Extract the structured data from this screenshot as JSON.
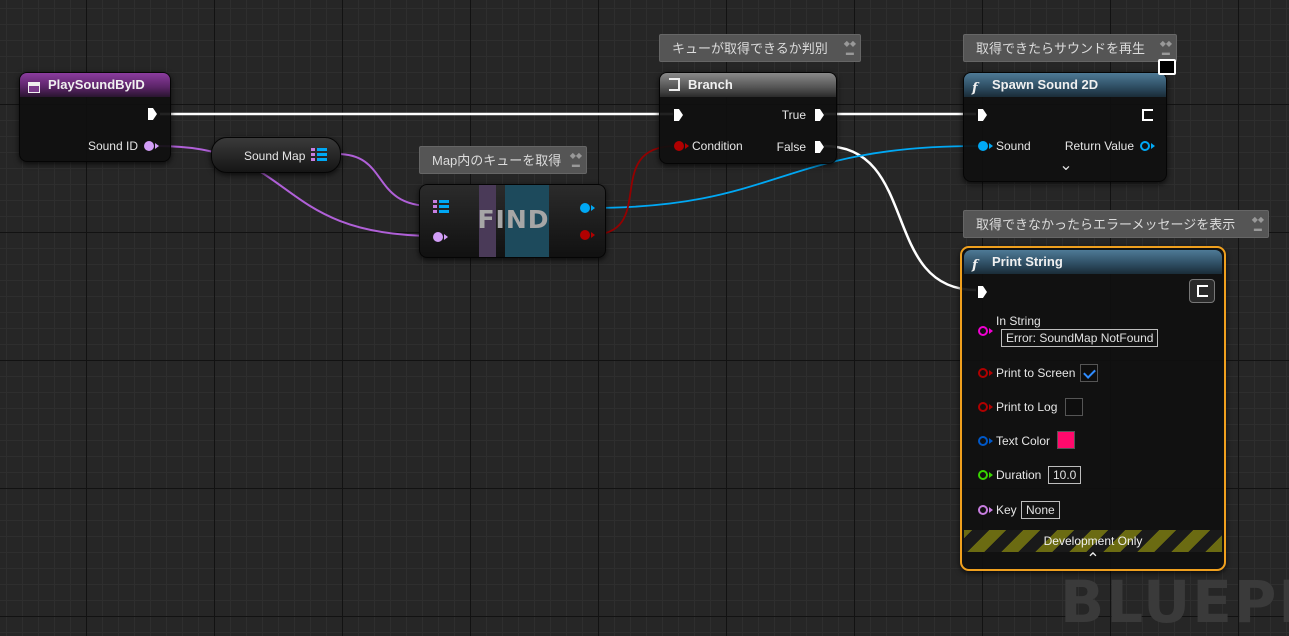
{
  "canvas": {
    "watermark": "BLUEPRI"
  },
  "comments": {
    "branch_comment": "キューが取得できるか判別",
    "spawn_comment": "取得できたらサウンドを再生",
    "find_comment": "Map内のキューを取得",
    "print_comment": "取得できなかったらエラーメッセージを表示"
  },
  "nodes": {
    "event": {
      "title": "PlaySoundByID",
      "sound_id_label": "Sound ID"
    },
    "sound_map": {
      "label": "Sound Map"
    },
    "find": {
      "label": "FIND"
    },
    "branch": {
      "title": "Branch",
      "true_label": "True",
      "false_label": "False",
      "condition_label": "Condition"
    },
    "spawn": {
      "title": "Spawn Sound 2D",
      "sound_label": "Sound",
      "return_label": "Return Value",
      "expand_glyph": "⌄"
    },
    "print": {
      "title": "Print String",
      "in_string_label": "In String",
      "in_string_value": "Error: SoundMap NotFound",
      "print_screen_label": "Print to Screen",
      "print_screen_checked": true,
      "print_log_label": "Print to Log",
      "print_log_checked": false,
      "text_color_label": "Text Color",
      "text_color": "#ff0a6c",
      "duration_label": "Duration",
      "duration_value": "10.0",
      "key_label": "Key",
      "key_value": "None",
      "dev_only": "Development Only",
      "collapse_glyph": "⌃"
    }
  },
  "colors": {
    "exec": "#ffffff",
    "object_pin": "#00a8f4",
    "bool_pin": "#940000",
    "int_pin": "#d29ef7",
    "string_pin": "#f100d2",
    "color_pin": "#0058c8",
    "float_pin": "#38d500",
    "name_pin": "#c87ee0",
    "selection": "#f0a01e"
  }
}
